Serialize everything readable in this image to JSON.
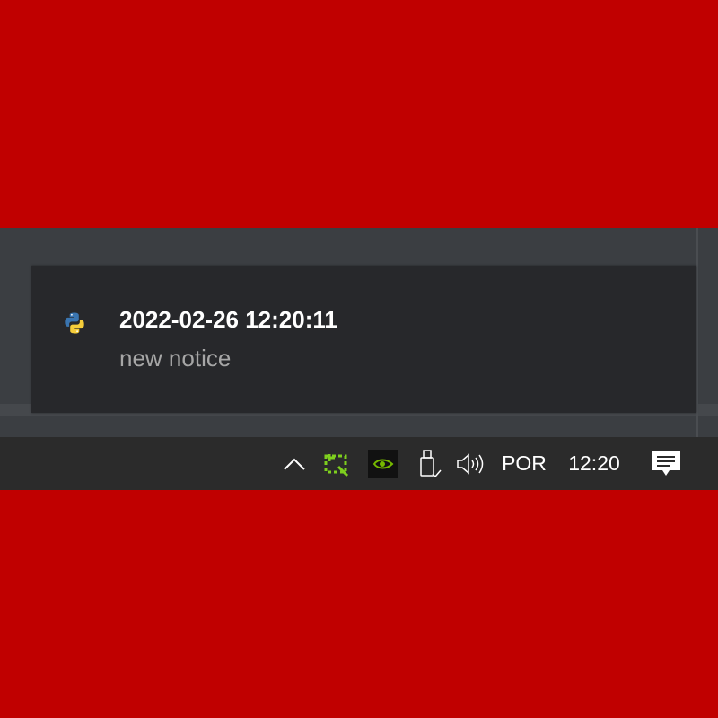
{
  "notification": {
    "app_icon": "python-icon",
    "title": "2022-02-26 12:20:11",
    "message": "new notice"
  },
  "taskbar": {
    "tray_icons": [
      {
        "name": "show-hidden-icons",
        "icon": "chevron-up-icon"
      },
      {
        "name": "snipping-tool",
        "icon": "green-crop-icon"
      },
      {
        "name": "nvidia",
        "icon": "nvidia-icon"
      },
      {
        "name": "usb-device",
        "icon": "usb-icon"
      },
      {
        "name": "volume",
        "icon": "speaker-icon"
      }
    ],
    "language": "POR",
    "clock": "12:20",
    "action_center_icon": "notification-icon"
  },
  "colors": {
    "background_border": "#c00000",
    "toast_bg": "#27282b",
    "taskbar_bg": "#2b2b2b",
    "nvidia_green": "#76b900"
  }
}
